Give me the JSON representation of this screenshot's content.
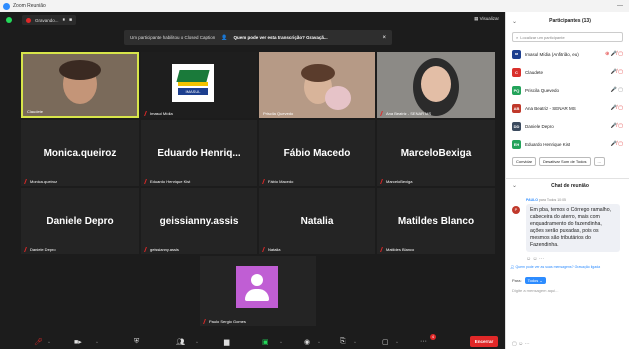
{
  "window": {
    "title": "Zoom Reunião",
    "controls": "—"
  },
  "topbar": {
    "recording_label": "Gravando...",
    "pause": "⏸",
    "stop": "■",
    "view_label": "▦ Visualizar"
  },
  "banner": {
    "message": "Um participante habilitou o Closed Caption",
    "question": "Quem pode ver esta transcrição? Gravaçã...",
    "close": "×"
  },
  "tiles": [
    {
      "name": "Claudete"
    },
    {
      "name": "Imasul Mídia",
      "logo_text": "IMASUL"
    },
    {
      "name": "Priscila Quevedo"
    },
    {
      "name": "Ana Beatriz - SENAR MS"
    },
    {
      "name": "Monica.queiroz",
      "display": "Monica.queiroz"
    },
    {
      "name": "Eduardo Henrique Kist",
      "display": "Eduardo  Henriq..."
    },
    {
      "name": "Fábio Macedo",
      "display": "Fábio Macedo"
    },
    {
      "name": "MarceloBexiga",
      "display": "MarceloBexiga"
    },
    {
      "name": "Daniele Depro",
      "display": "Daniele Depro"
    },
    {
      "name": "geissianny.assis",
      "display": "geissianny.assis"
    },
    {
      "name": "Natalia",
      "display": "Natalia"
    },
    {
      "name": "Matildes Blanco",
      "display": "Matildes Blanco"
    },
    {
      "name": "Paulo Sergio Gomes"
    }
  ],
  "toolbar": {
    "end_label": "Encerrar",
    "badge": "4"
  },
  "panel": {
    "title": "Participantes (13)",
    "search_placeholder": "Localizar um participante",
    "participants": [
      {
        "initials": "",
        "label": "Imasul Mídia (Anfitrião, eu)",
        "color": "#ffffff",
        "icons": "⊕ 🎤̸ ▢"
      },
      {
        "initials": "C",
        "label": "Claudete",
        "color": "#d9302c",
        "icons": "🎤̸ ▢"
      },
      {
        "initials": "PQ",
        "label": "Priscila Quevedo",
        "color": "#23a35a",
        "icons": "🎤 ▢"
      },
      {
        "initials": "AB",
        "label": "Ana Beatriz - SENAR MS",
        "color": "#c0392b",
        "icons": "🎤̸ ▢"
      },
      {
        "initials": "DD",
        "label": "Daniele Depro",
        "color": "#3b4a5e",
        "icons": "🎤̸ ▢"
      },
      {
        "initials": "EH",
        "label": "Eduardo Henrique Kist",
        "color": "#23a35a",
        "icons": "🎤̸ ▢"
      }
    ],
    "buttons": [
      "Convidar",
      "Desativar Som de Todos",
      "..."
    ],
    "chat": {
      "title": "Chat de reunião",
      "sender": "PAULO",
      "to": "para Todos",
      "time": "10:05",
      "avatar": "P",
      "message": "Em pba, temos o Córrego ramalho, cabeceira do aterro, mais com enquadramento do fazendinha, ações serão puxadas, pois os mesmos são tributários do Fazendinha.",
      "reacts": "☺ ☺ ···",
      "notice": "Quem pode ver as suas mensagens? Gravação ligada",
      "to_label": "Para:",
      "to_value": "Todos ⌄",
      "input_placeholder": "Digite a mensagem aqui...",
      "bottom_icons": "▢ ☺ ···"
    }
  },
  "colors": {
    "accent": "#2d8cff",
    "danger": "#e02828",
    "active_speaker": "#d8e54a"
  }
}
